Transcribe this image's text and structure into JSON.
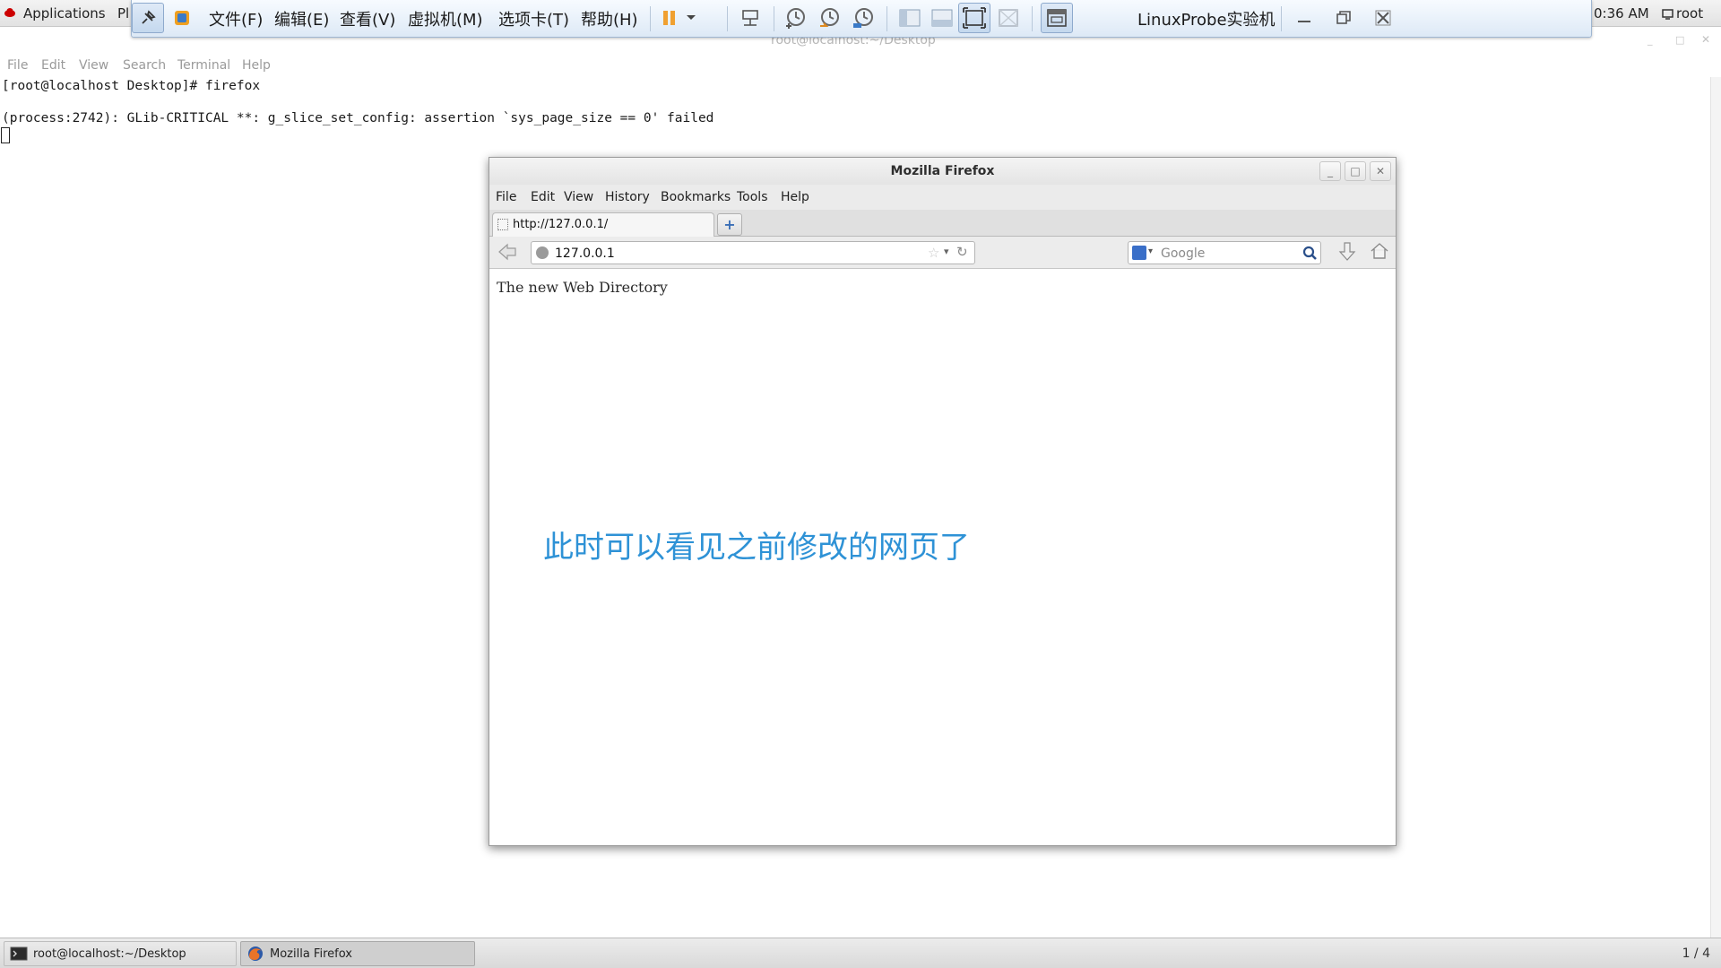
{
  "gnome_panel": {
    "applications": "Applications",
    "places": "Pl",
    "clock": "0:36 AM",
    "user": "root"
  },
  "vm_toolbar": {
    "menus": [
      "文件(F)",
      "编辑(E)",
      "查看(V)",
      "虚拟机(M)",
      "选项卡(T)",
      "帮助(H)"
    ],
    "title": "LinuxProbe实验机"
  },
  "terminal": {
    "title": "root@localhost:~/Desktop",
    "menus": [
      "File",
      "Edit",
      "View",
      "Search",
      "Terminal",
      "Help"
    ],
    "lines": [
      "[root@localhost Desktop]# firefox",
      "(process:2742): GLib-CRITICAL **: g_slice_set_config: assertion `sys_page_size == 0' failed"
    ]
  },
  "firefox": {
    "title": "Mozilla Firefox",
    "menus": [
      "File",
      "Edit",
      "View",
      "History",
      "Bookmarks",
      "Tools",
      "Help"
    ],
    "tab_label": "http://127.0.0.1/",
    "url": "127.0.0.1",
    "search_placeholder": "Google",
    "page_text": "The new Web Directory"
  },
  "annotation": "此时可以看见之前修改的网页了",
  "taskbar": {
    "items": [
      "root@localhost:~/Desktop",
      "Mozilla Firefox"
    ],
    "workspace": "1 / 4"
  }
}
